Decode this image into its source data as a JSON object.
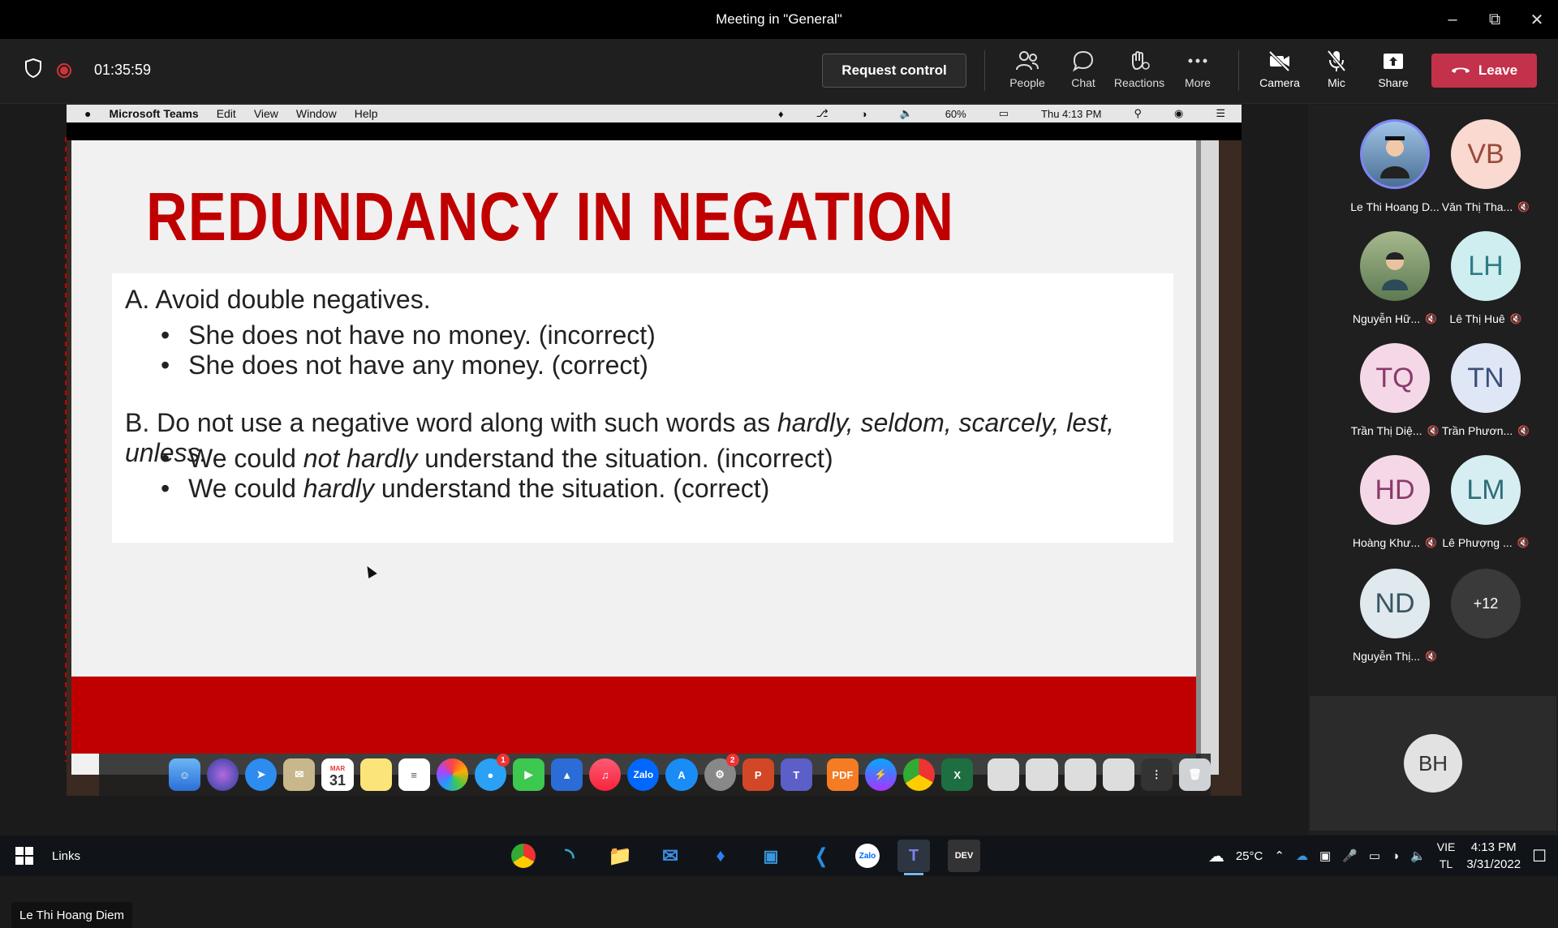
{
  "window": {
    "title": "Meeting in \"General\""
  },
  "toolbar": {
    "timer": "01:35:59",
    "request_control": "Request control",
    "buttons": [
      {
        "label": "People",
        "icon": "people-icon"
      },
      {
        "label": "Chat",
        "icon": "chat-icon"
      },
      {
        "label": "Reactions",
        "icon": "reactions-icon"
      },
      {
        "label": "More",
        "icon": "more-icon"
      },
      {
        "label": "Camera",
        "icon": "camera-off-icon"
      },
      {
        "label": "Mic",
        "icon": "mic-off-icon"
      },
      {
        "label": "Share",
        "icon": "share-icon"
      }
    ],
    "leave": "Leave",
    "leave_color": "#c4314b"
  },
  "mac_menu": {
    "app": "Microsoft Teams",
    "items": [
      "Edit",
      "View",
      "Window",
      "Help"
    ],
    "battery": "60%",
    "clock": "Thu 4:13 PM"
  },
  "slide": {
    "title": "REDUNDANCY IN NEGATION",
    "title_color": "#c00000",
    "item_a": "A. Avoid double negatives.",
    "a_bullets": [
      "She does not have no money. (incorrect)",
      "She does not have any money. (correct)"
    ],
    "item_b_prefix": "B. Do not use a negative word along with such words as ",
    "item_b_words": "hardly, seldom, scarcely, lest, unless.",
    "b_bullet1_pre": "We could ",
    "b_bullet1_em": "not hardly",
    "b_bullet1_post": " understand the situation. (incorrect)",
    "b_bullet2_pre": "We could ",
    "b_bullet2_em": "hardly",
    "b_bullet2_post": " understand the situation. (correct)"
  },
  "dock": {
    "calendar_month": "MAR",
    "calendar_day": "31",
    "messages_badge": "1",
    "settings_badge": "2"
  },
  "speaker_label": "Le Thi Hoang Diem",
  "participants": [
    {
      "initials": "",
      "name": "Le Thi Hoang D...",
      "muted": false,
      "photo": true,
      "color": "#5b7fa8"
    },
    {
      "initials": "VB",
      "name": "Văn Thị Tha...",
      "muted": true,
      "color": "#f9d9d0"
    },
    {
      "initials": "",
      "name": "Nguyễn Hữ...",
      "muted": true,
      "photo": true,
      "color": "#8aa07a"
    },
    {
      "initials": "LH",
      "name": "Lê Thị Huê",
      "muted": true,
      "color": "#cfeef0"
    },
    {
      "initials": "TQ",
      "name": "Trần Thị Diệ...",
      "muted": true,
      "color": "#f4d8e8"
    },
    {
      "initials": "TN",
      "name": "Trần Phươn...",
      "muted": true,
      "color": "#dfe6f5"
    },
    {
      "initials": "HD",
      "name": "Hoàng Khư...",
      "muted": true,
      "color": "#f4d8e8"
    },
    {
      "initials": "LM",
      "name": "Lê Phượng ...",
      "muted": true,
      "color": "#d6eef2"
    },
    {
      "initials": "ND",
      "name": "Nguyễn Thị...",
      "muted": true,
      "color": "#dfe9ee"
    },
    {
      "initials": "+12",
      "name": "",
      "muted": false,
      "color": "#3a3a3a"
    }
  ],
  "bh_tile": {
    "initials": "BH"
  },
  "taskbar": {
    "links": "Links",
    "weather": "25°C",
    "lang_top": "VIE",
    "lang_bottom": "TL",
    "time": "4:13 PM",
    "date": "3/31/2022"
  }
}
